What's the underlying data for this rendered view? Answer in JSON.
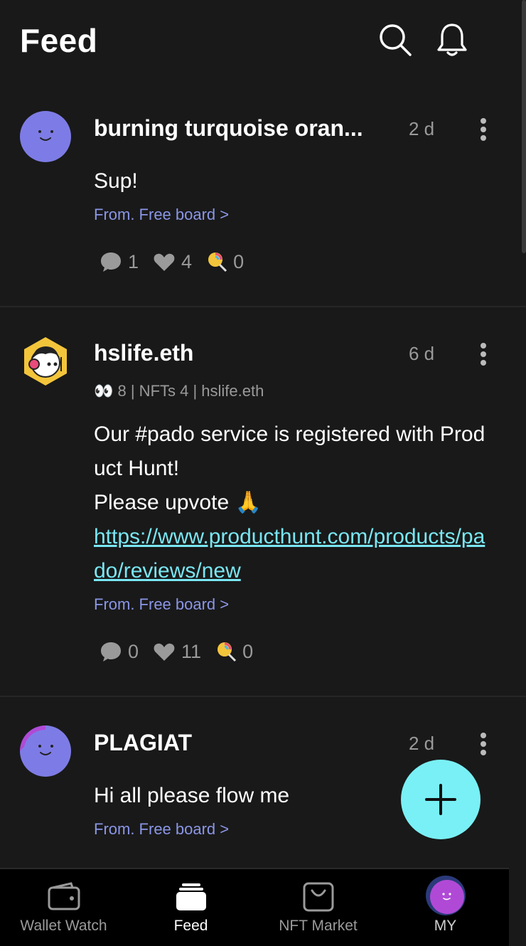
{
  "header": {
    "title": "Feed"
  },
  "posts": [
    {
      "author": "burning turquoise oran...",
      "time": "2 d",
      "body": "Sup!",
      "from": "From. Free board >",
      "comments": "1",
      "likes": "4",
      "candies": "0"
    },
    {
      "author": "hslife.eth",
      "time": "6 d",
      "meta": "👀 8 | NFTs 4 | hslife.eth",
      "body_lines": [
        "Our #pado service is registered with Product Hunt!",
        "Please upvote 🙏"
      ],
      "link": "https://www.producthunt.com/products/pado/reviews/new",
      "from": "From. Free board >",
      "comments": "0",
      "likes": "11",
      "candies": "0"
    },
    {
      "author": "PLAGIAT",
      "time": "2 d",
      "body": "Hi all please flow me",
      "from": "From. Free board >"
    }
  ],
  "tabs": [
    {
      "label": "Wallet Watch",
      "icon": "wallet-icon"
    },
    {
      "label": "Feed",
      "icon": "feed-icon",
      "active": true
    },
    {
      "label": "NFT Market",
      "icon": "shopping-bag-icon"
    },
    {
      "label": "MY",
      "icon": "avatar"
    }
  ],
  "colors": {
    "accent": "#79f0f5",
    "link": "#79e6f2",
    "from": "#8a96e6",
    "background": "#191919"
  }
}
